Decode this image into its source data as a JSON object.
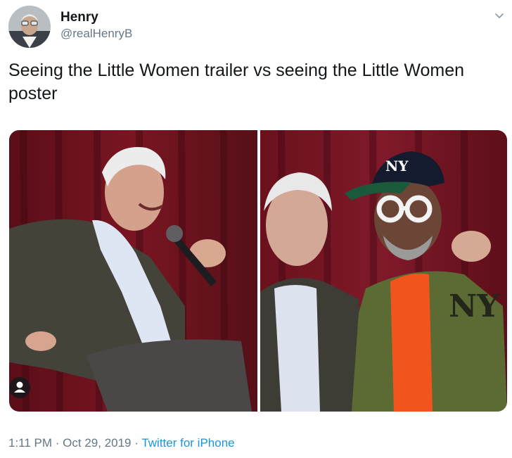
{
  "author": {
    "name": "Henry",
    "handle": "@realHenryB"
  },
  "tweet": {
    "text": "Seeing the Little Women trailer vs seeing the Little Women poster"
  },
  "media": {
    "count": 2,
    "left_photo_icon": "person-icon",
    "menu_icon": "chevron-down-icon"
  },
  "meta": {
    "time": "1:11 PM",
    "separator": " · ",
    "date": "Oct 29, 2019",
    "source": "Twitter for iPhone"
  },
  "colors": {
    "text": "#14171a",
    "secondary": "#657786",
    "link": "#1b95e0"
  }
}
